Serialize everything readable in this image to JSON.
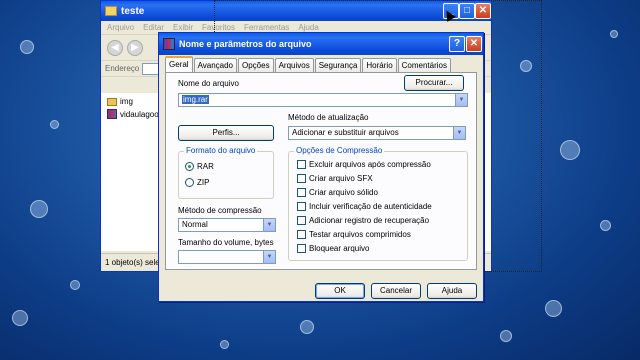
{
  "explorer": {
    "title": "teste",
    "menu": [
      "Arquivo",
      "Editar",
      "Exibir",
      "Favoritos",
      "Ferramentas",
      "Ajuda"
    ],
    "address_label": "Endereço",
    "files": [
      {
        "name": "img",
        "icon": "folder-icon"
      },
      {
        "name": "vidaulagoog",
        "icon": "winrar-archive-icon"
      }
    ],
    "status": "1 objeto(s) selecionado(s)"
  },
  "dialog": {
    "title": "Nome e parâmetros do arquivo",
    "tabs": [
      "Geral",
      "Avançado",
      "Opções",
      "Arquivos",
      "Segurança",
      "Horário",
      "Comentários"
    ],
    "active_tab": "Geral",
    "archive_name_label": "Nome do arquivo",
    "browse_button": "Procurar...",
    "archive_name_value": "img.rar",
    "profiles_button": "Perfis...",
    "update_method_label": "Método de atualização",
    "update_method_value": "Adicionar e substituir arquivos",
    "format_group_title": "Formato do arquivo",
    "format_options": [
      {
        "label": "RAR",
        "selected": true
      },
      {
        "label": "ZIP",
        "selected": false
      }
    ],
    "compression_method_label": "Método de compressão",
    "compression_method_value": "Normal",
    "volume_size_label": "Tamanho do volume, bytes",
    "volume_size_value": "",
    "options_group_title": "Opções de Compressão",
    "options": [
      {
        "label": "Excluir arquivos após compressão",
        "checked": false
      },
      {
        "label": "Criar arquivo SFX",
        "checked": false
      },
      {
        "label": "Criar arquivo sólido",
        "checked": false
      },
      {
        "label": "Incluir verificação de autenticidade",
        "checked": false
      },
      {
        "label": "Adicionar registro de recuperação",
        "checked": false
      },
      {
        "label": "Testar arquivos comprimidos",
        "checked": false
      },
      {
        "label": "Bloquear arquivo",
        "checked": false
      }
    ],
    "ok_button": "OK",
    "cancel_button": "Cancelar",
    "help_button": "Ajuda"
  },
  "colors": {
    "titlebar_blue": "#0a4ad8",
    "dialog_face": "#ece9d8",
    "tab_highlight": "#f0a72a",
    "group_title": "#0046d5",
    "desktop_blue": "#1f5aa6"
  }
}
